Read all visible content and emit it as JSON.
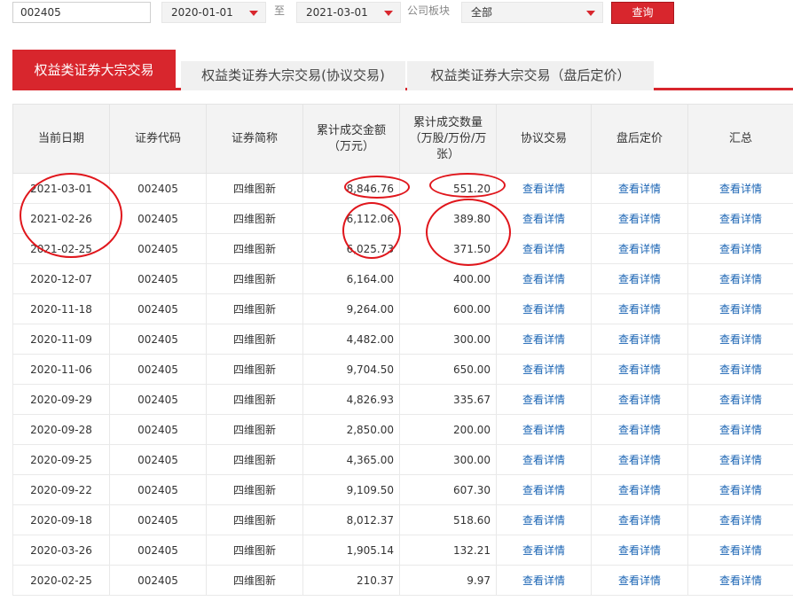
{
  "filters": {
    "code_value": "002405",
    "start_date": "2020-01-01",
    "to_label": "至",
    "end_date": "2021-03-01",
    "board_label": "公司板块",
    "board_value": "全部",
    "query_label": "查询"
  },
  "tabs": [
    {
      "label": "权益类证券大宗交易",
      "active": true
    },
    {
      "label": "权益类证券大宗交易(协议交易)",
      "active": false
    },
    {
      "label": "权益类证券大宗交易（盘后定价）",
      "active": false
    }
  ],
  "table": {
    "headers": [
      "当前日期",
      "证券代码",
      "证券简称",
      "累计成交金额（万元）",
      "累计成交数量（万股/万份/万张）",
      "协议交易",
      "盘后定价",
      "汇总"
    ],
    "detail_label": "查看详情",
    "rows": [
      {
        "date": "2021-03-01",
        "code": "002405",
        "name": "四维图新",
        "amount": "8,846.76",
        "volume": "551.20"
      },
      {
        "date": "2021-02-26",
        "code": "002405",
        "name": "四维图新",
        "amount": "6,112.06",
        "volume": "389.80"
      },
      {
        "date": "2021-02-25",
        "code": "002405",
        "name": "四维图新",
        "amount": "6,025.73",
        "volume": "371.50"
      },
      {
        "date": "2020-12-07",
        "code": "002405",
        "name": "四维图新",
        "amount": "6,164.00",
        "volume": "400.00"
      },
      {
        "date": "2020-11-18",
        "code": "002405",
        "name": "四维图新",
        "amount": "9,264.00",
        "volume": "600.00"
      },
      {
        "date": "2020-11-09",
        "code": "002405",
        "name": "四维图新",
        "amount": "4,482.00",
        "volume": "300.00"
      },
      {
        "date": "2020-11-06",
        "code": "002405",
        "name": "四维图新",
        "amount": "9,704.50",
        "volume": "650.00"
      },
      {
        "date": "2020-09-29",
        "code": "002405",
        "name": "四维图新",
        "amount": "4,826.93",
        "volume": "335.67"
      },
      {
        "date": "2020-09-28",
        "code": "002405",
        "name": "四维图新",
        "amount": "2,850.00",
        "volume": "200.00"
      },
      {
        "date": "2020-09-25",
        "code": "002405",
        "name": "四维图新",
        "amount": "4,365.00",
        "volume": "300.00"
      },
      {
        "date": "2020-09-22",
        "code": "002405",
        "name": "四维图新",
        "amount": "9,109.50",
        "volume": "607.30"
      },
      {
        "date": "2020-09-18",
        "code": "002405",
        "name": "四维图新",
        "amount": "8,012.37",
        "volume": "518.60"
      },
      {
        "date": "2020-03-26",
        "code": "002405",
        "name": "四维图新",
        "amount": "1,905.14",
        "volume": "132.21"
      },
      {
        "date": "2020-02-25",
        "code": "002405",
        "name": "四维图新",
        "amount": "210.37",
        "volume": "9.97"
      }
    ]
  },
  "colors": {
    "accent": "#d8262d",
    "link": "#1a64b4",
    "annotation": "#e0161c"
  }
}
